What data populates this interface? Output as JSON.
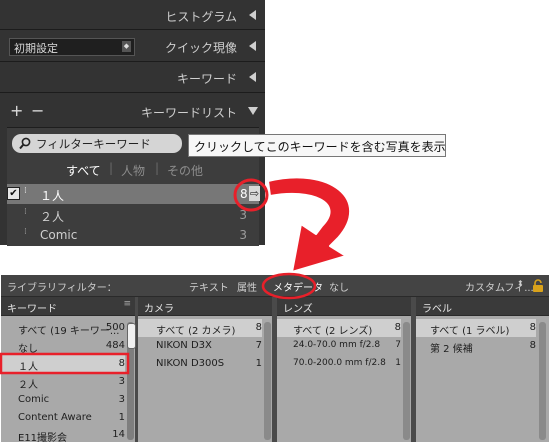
{
  "develop_panel": {
    "histogram_label": "ヒストグラム",
    "preset_value": "初期設定",
    "quick_develop_label": "クイック現像",
    "keywording_label": "キーワード",
    "keyword_list_label": "キーワードリスト",
    "add_symbol": "+",
    "remove_symbol": "−",
    "filter_placeholder": "フィルターキーワード",
    "tabs": [
      "すべて",
      "人物",
      "その他"
    ],
    "tooltip": "クリックしてこのキーワードを含む写真を表示",
    "keywords": [
      {
        "label": "１人",
        "count": "8"
      },
      {
        "label": "２人",
        "count": "3"
      },
      {
        "label": "Comic",
        "count": "3"
      }
    ]
  },
  "library_filter": {
    "label": "ライブラリフィルター：",
    "tabs": [
      "テキスト",
      "属性",
      "メタデータ",
      "なし"
    ],
    "custom_filter": "カスタムフィ...",
    "columns": [
      {
        "header": "キーワード",
        "rows": [
          {
            "label": "すべて (19 キーワー...",
            "count": "500"
          },
          {
            "label": "なし",
            "count": "484"
          },
          {
            "label": "１人",
            "count": "8"
          },
          {
            "label": "２人",
            "count": "3"
          },
          {
            "label": "Comic",
            "count": "3"
          },
          {
            "label": "Content Aware",
            "count": "1"
          },
          {
            "label": "E11撮影会",
            "count": "14"
          }
        ]
      },
      {
        "header": "カメラ",
        "rows": [
          {
            "label": "すべて (2 カメラ)",
            "count": "8"
          },
          {
            "label": "NIKON D3X",
            "count": "7"
          },
          {
            "label": "NIKON D300S",
            "count": "1"
          }
        ]
      },
      {
        "header": "レンズ",
        "rows": [
          {
            "label": "すべて (2 レンズ)",
            "count": "8"
          },
          {
            "label": "24.0-70.0 mm f/2.8",
            "count": "7"
          },
          {
            "label": "70.0-200.0 mm f/2.8",
            "count": "1"
          }
        ]
      },
      {
        "header": "ラベル",
        "rows": [
          {
            "label": "すべて (1 ラベル)",
            "count": "8"
          },
          {
            "label": "第 2 候補",
            "count": "8"
          }
        ]
      }
    ]
  },
  "colors": {
    "highlight": "#e8202a",
    "panel_dark": "#333333",
    "filter_body": "#a9a9a9"
  }
}
